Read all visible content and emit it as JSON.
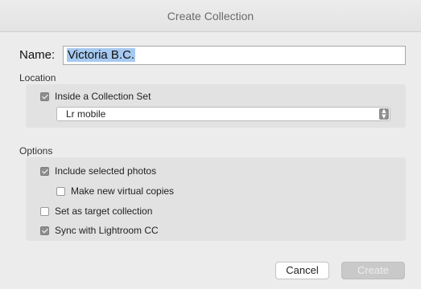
{
  "window": {
    "title": "Create Collection"
  },
  "name": {
    "label": "Name:",
    "value": "Victoria B.C."
  },
  "location": {
    "heading": "Location",
    "inside_set": {
      "label": "Inside a Collection Set",
      "checked": true
    },
    "set_select": {
      "value": "Lr mobile"
    }
  },
  "options": {
    "heading": "Options",
    "include_selected": {
      "label": "Include selected photos",
      "checked": true
    },
    "virtual_copies": {
      "label": "Make new virtual copies",
      "checked": false
    },
    "target_collection": {
      "label": "Set as target collection",
      "checked": false
    },
    "sync": {
      "label": "Sync with Lightroom CC",
      "checked": true
    }
  },
  "buttons": {
    "cancel": "Cancel",
    "create": "Create"
  },
  "colors": {
    "selection": "#a6c9f0",
    "panel": "#e2e2e2",
    "background": "#ececec"
  }
}
